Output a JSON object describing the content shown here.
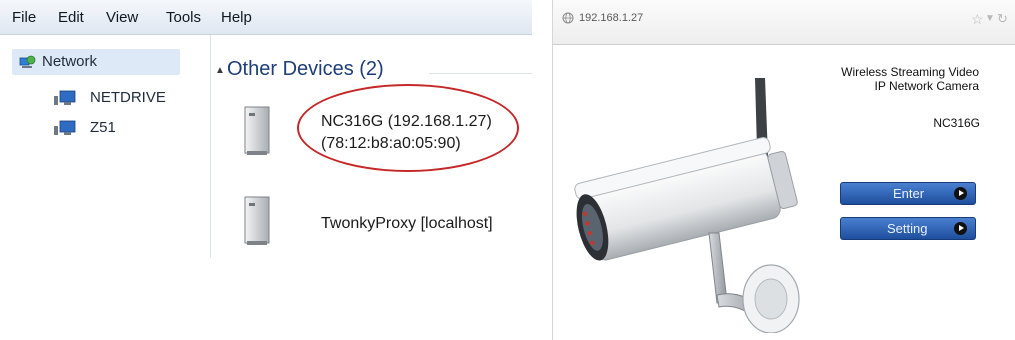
{
  "explorer": {
    "menu": [
      "File",
      "Edit",
      "View",
      "Tools",
      "Help"
    ],
    "nav": {
      "network_label": "Network",
      "items": [
        "NETDRIVE",
        "Z51"
      ]
    },
    "group_header": "Other Devices (2)",
    "devices": [
      {
        "name": "NC316G (192.168.1.27)",
        "detail": "(78:12:b8:a0:05:90)"
      },
      {
        "name": "TwonkyProxy [localhost]"
      }
    ]
  },
  "browser": {
    "url": "192.168.1.27",
    "product_line1": "Wireless Streaming Video",
    "product_line2": "IP Network Camera",
    "model": "NC316G",
    "buttons": {
      "enter_label": "Enter",
      "setting_label": "Setting"
    },
    "colors": {
      "button_blue": "#2a5fb0",
      "highlight_red": "#c62828"
    }
  }
}
